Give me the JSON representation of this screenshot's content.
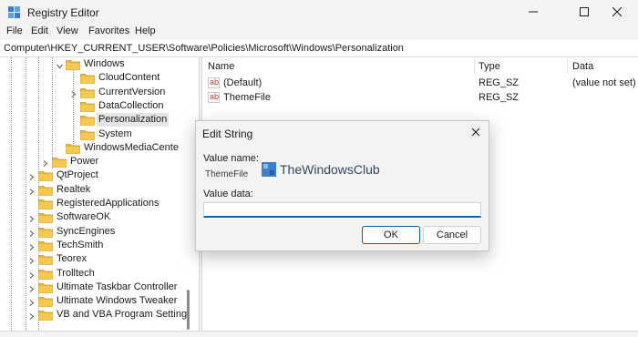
{
  "window": {
    "title": "Registry Editor"
  },
  "menu": [
    "File",
    "Edit",
    "View",
    "Favorites",
    "Help"
  ],
  "address": "Computer\\HKEY_CURRENT_USER\\Software\\Policies\\Microsoft\\Windows\\Personalization",
  "tree": {
    "items": [
      {
        "label": "Windows",
        "expanded": true
      },
      {
        "label": "CloudContent"
      },
      {
        "label": "CurrentVersion",
        "expandable": true
      },
      {
        "label": "DataCollection"
      },
      {
        "label": "Personalization",
        "selected": true
      },
      {
        "label": "System"
      },
      {
        "label": "WindowsMediaCente"
      },
      {
        "label": "Power",
        "expandable": true
      },
      {
        "label": "QtProject",
        "expandable": true
      },
      {
        "label": "Realtek",
        "expandable": true
      },
      {
        "label": "RegisteredApplications"
      },
      {
        "label": "SoftwareOK",
        "expandable": true
      },
      {
        "label": "SyncEngines",
        "expandable": true
      },
      {
        "label": "TechSmith",
        "expandable": true
      },
      {
        "label": "Teorex",
        "expandable": true
      },
      {
        "label": "Trolltech",
        "expandable": true
      },
      {
        "label": "Ultimate Taskbar Controller",
        "expandable": true
      },
      {
        "label": "Ultimate Windows Tweaker",
        "expandable": true
      },
      {
        "label": "VB and VBA Program Setting",
        "expandable": true
      }
    ]
  },
  "values": {
    "columns": [
      "Name",
      "Type",
      "Data"
    ],
    "rows": [
      {
        "name": "(Default)",
        "type": "REG_SZ",
        "data": "(value not set)"
      },
      {
        "name": "ThemeFile",
        "type": "REG_SZ",
        "data": ""
      }
    ],
    "icon_text": "ab"
  },
  "dialog": {
    "title": "Edit String",
    "value_name_label": "Value name:",
    "value_name": "ThemeFile",
    "value_data_label": "Value data:",
    "value_data": "",
    "ok_label": "OK",
    "cancel_label": "Cancel"
  },
  "watermark": {
    "text": "TheWindowsClub",
    "color": "#2f4760"
  },
  "colors": {
    "accent": "#0063b1",
    "folder": "#e8b73d",
    "chrome": "#f3f3f3"
  }
}
